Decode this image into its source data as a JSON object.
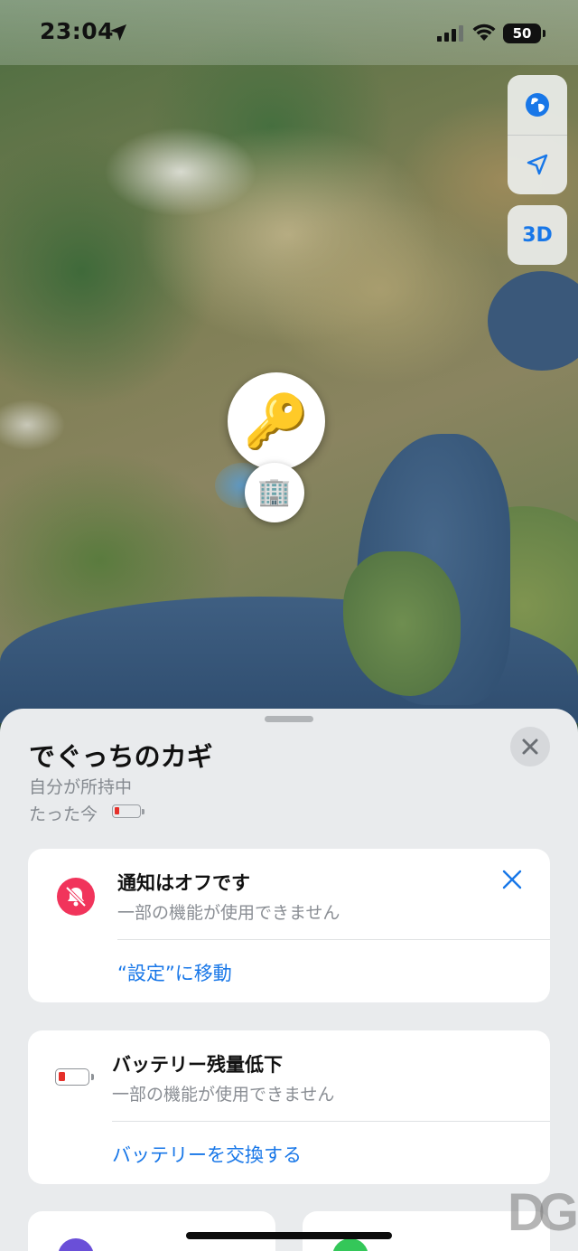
{
  "status_bar": {
    "time": "23:04",
    "battery_level": "50",
    "icons": [
      "location-arrow-icon",
      "cellular-signal-icon",
      "wifi-icon",
      "battery-icon"
    ]
  },
  "map": {
    "controls": {
      "globe_icon": "globe-icon",
      "location_icon": "location-arrow-icon",
      "three_d_label": "3D"
    },
    "pins": {
      "item_emoji": "🔑",
      "place_emoji": "🏢"
    }
  },
  "sheet": {
    "title": "でぐっちのカギ",
    "owner_status": "自分が所持中",
    "last_updated": "たった今",
    "notification_card": {
      "title": "通知はオフです",
      "subtitle": "一部の機能が使用できません",
      "link": "“設定”に移動",
      "accent_color": "#f1345b"
    },
    "battery_card": {
      "title": "バッテリー残量低下",
      "subtitle": "一部の機能が使用できません",
      "link": "バッテリーを交換する"
    }
  },
  "colors": {
    "link_blue": "#1877e8",
    "battery_low_red": "#e5302a"
  }
}
